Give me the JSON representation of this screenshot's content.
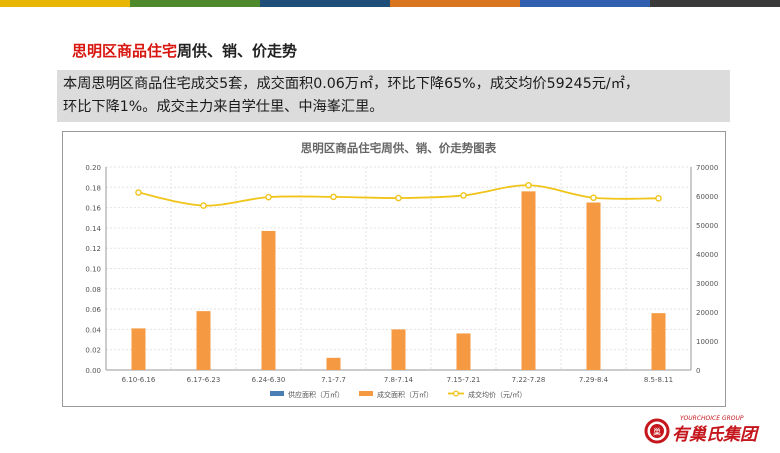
{
  "page": {
    "heading_highlight": "思明区商品住宅",
    "heading_rest": "周供、销、价走势",
    "summary_line1": "本周思明区商品住宅成交5套，成交面积0.06万㎡，环比下降65%，成交均价59245元/㎡，",
    "summary_line2": "环比下降1%。成交主力来自学仕里、中海峯汇里。",
    "topbar_colors": [
      "#e8b600",
      "#4e8a2c",
      "#1f4e79",
      "#d9751e",
      "#2f5fae",
      "#3a3a3a"
    ],
    "logo": {
      "subtitle": "YOURCHOICE GROUP",
      "name": "有巢氏集团",
      "emblem_text": "巢",
      "color": "#c4161c"
    }
  },
  "chart_data": {
    "type": "bar",
    "title": "思明区商品住宅周供、销、价走势图表",
    "categories": [
      "6.10-6.16",
      "6.17-6.23",
      "6.24-6.30",
      "7.1-7.7",
      "7.8-7.14",
      "7.15-7.21",
      "7.22-7.28",
      "7.29-8.4",
      "8.5-8.11"
    ],
    "series": [
      {
        "name": "供应面积（万㎡）",
        "type": "bar",
        "axis": "left",
        "color": "#4a7eb4",
        "values": [
          0,
          0,
          0,
          0,
          0,
          0,
          0,
          0,
          0
        ]
      },
      {
        "name": "成交面积（万㎡）",
        "type": "bar",
        "axis": "left",
        "color": "#f59a42",
        "values": [
          0.041,
          0.058,
          0.137,
          0.012,
          0.04,
          0.036,
          0.176,
          0.165,
          0.056
        ]
      },
      {
        "name": "成交均价（元/㎡）",
        "type": "line",
        "axis": "right",
        "color": "#f0c419",
        "values": [
          61200,
          56700,
          59600,
          59700,
          59300,
          60200,
          63700,
          59400,
          59200
        ]
      }
    ],
    "y_left": {
      "min": 0,
      "max": 0.2,
      "ticks": [
        "0.00",
        "0.02",
        "0.04",
        "0.06",
        "0.08",
        "0.10",
        "0.12",
        "0.14",
        "0.16",
        "0.18",
        "0.20"
      ]
    },
    "y_right": {
      "min": 0,
      "max": 70000,
      "ticks": [
        "0",
        "10000",
        "20000",
        "30000",
        "40000",
        "50000",
        "60000",
        "70000"
      ]
    },
    "grid": true,
    "legend_position": "bottom"
  }
}
